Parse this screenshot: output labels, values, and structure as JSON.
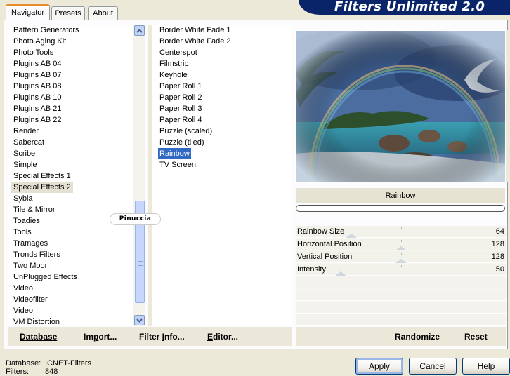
{
  "banner": {
    "title": "Filters Unlimited 2.0"
  },
  "tabs": [
    {
      "label": "Navigator",
      "active": true
    },
    {
      "label": "Presets",
      "active": false
    },
    {
      "label": "About",
      "active": false
    }
  ],
  "categories": {
    "items": [
      "Pattern Generators",
      "Photo Aging Kit",
      "Photo Tools",
      "Plugins AB 04",
      "Plugins AB 07",
      "Plugins AB 08",
      "Plugins AB 10",
      "Plugins AB 21",
      "Plugins AB 22",
      "Render",
      "Sabercat",
      "Scribe",
      "Simple",
      "Special Effects 1",
      "Special Effects 2",
      "Sybia",
      "Tile & Mirror",
      "Toadies",
      "Tools",
      "Tramages",
      "Tronds Filters",
      "Two Moon",
      "UnPlugged Effects",
      "Video",
      "Videofilter",
      "Video",
      "VM Distortion"
    ],
    "selected_index": 14
  },
  "filters": {
    "items": [
      "Border White Fade 1",
      "Border White Fade 2",
      "Centerspot",
      "Filmstrip",
      "Keyhole",
      "Paper Roll 1",
      "Paper Roll 2",
      "Paper Roll 3",
      "Paper Roll 4",
      "Puzzle (scaled)",
      "Puzzle (tiled)",
      "Rainbow",
      "TV Screen"
    ],
    "selected_index": 11
  },
  "watermark": {
    "text": "Pinuccia"
  },
  "preview": {
    "caption": "Rainbow"
  },
  "params": [
    {
      "label": "Rainbow Size",
      "value": "64",
      "slider_fraction": 0.25
    },
    {
      "label": "Horizontal Position",
      "value": "128",
      "slider_fraction": 0.5
    },
    {
      "label": "Vertical Position",
      "value": "128",
      "slider_fraction": 0.5
    },
    {
      "label": "Intensity",
      "value": "50",
      "slider_fraction": 0.2
    }
  ],
  "toolbar": {
    "database": {
      "ul": "D",
      "rest": "atabase"
    },
    "import": {
      "pre": "Im",
      "ul": "p",
      "rest": "ort..."
    },
    "filter_info": {
      "pre": "Filter ",
      "ul": "I",
      "rest": "nfo..."
    },
    "editor": {
      "ul": "E",
      "rest": "ditor..."
    },
    "randomize": "Randomize",
    "reset": "Reset"
  },
  "status": {
    "database_label": "Database:",
    "database_value": "ICNET-Filters",
    "filters_label": "Filters:",
    "filters_value": "848"
  },
  "buttons": {
    "apply": "Apply",
    "cancel": "Cancel",
    "help": "Help"
  },
  "colors": {
    "banner": "#0a246a",
    "selection": "#316ac5",
    "window": "#ece9d8",
    "tab_accent": "#e68b2c"
  },
  "icons": {
    "scroll_up": "chevron-up-icon",
    "scroll_down": "chevron-down-icon"
  }
}
